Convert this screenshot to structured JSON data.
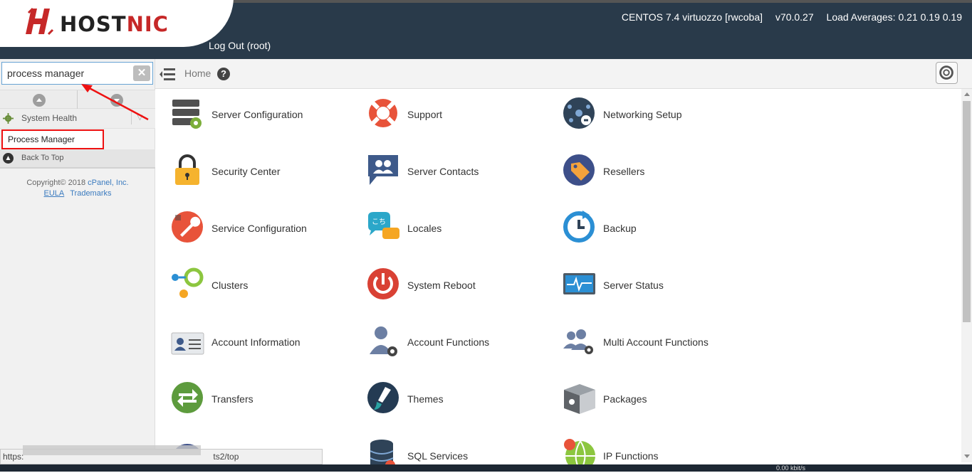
{
  "brand": {
    "logo_prefix": "HOST",
    "logo_suffix": "NIC",
    "accent": "#c62828"
  },
  "header": {
    "server_name": "CENTOS 7.4 virtuozzo [rwcoba]",
    "version": "v70.0.27",
    "load_averages": "Load Averages: 0.21 0.19 0.19",
    "logout_label": "Log Out (root)"
  },
  "breadcrumb": {
    "home_label": "Home",
    "help_glyph": "?"
  },
  "sidebar": {
    "search_value": "process manager",
    "group_label": "System Health",
    "active_item": "Process Manager",
    "back_to_top": "Back To Top",
    "copyright_prefix": "Copyright© 2018",
    "copyright_company": "cPanel, Inc.",
    "eula_label": "EULA",
    "trademarks_label": "Trademarks"
  },
  "tiles": [
    {
      "label": "Server Configuration",
      "icon": "server-config-icon"
    },
    {
      "label": "Support",
      "icon": "lifebuoy-icon"
    },
    {
      "label": "Networking Setup",
      "icon": "network-icon"
    },
    {
      "label": "Security Center",
      "icon": "padlock-icon"
    },
    {
      "label": "Server Contacts",
      "icon": "contacts-icon"
    },
    {
      "label": "Resellers",
      "icon": "tag-icon"
    },
    {
      "label": "Service Configuration",
      "icon": "wrench-icon"
    },
    {
      "label": "Locales",
      "icon": "speech-bubbles-icon"
    },
    {
      "label": "Backup",
      "icon": "clock-icon"
    },
    {
      "label": "Clusters",
      "icon": "clusters-icon"
    },
    {
      "label": "System Reboot",
      "icon": "power-icon"
    },
    {
      "label": "Server Status",
      "icon": "monitor-icon"
    },
    {
      "label": "Account Information",
      "icon": "id-card-icon"
    },
    {
      "label": "Account Functions",
      "icon": "user-gear-icon"
    },
    {
      "label": "Multi Account Functions",
      "icon": "users-gear-icon"
    },
    {
      "label": "Transfers",
      "icon": "transfer-arrows-icon"
    },
    {
      "label": "Themes",
      "icon": "brush-icon"
    },
    {
      "label": "Packages",
      "icon": "box-icon"
    },
    {
      "label": "",
      "icon": "partial-icon"
    },
    {
      "label": "SQL Services",
      "icon": "database-icon"
    },
    {
      "label": "IP Functions",
      "icon": "globe-ip-icon"
    }
  ],
  "status_bar": {
    "url_prefix": "https:",
    "url_suffix": "ts2/top"
  },
  "taskbar": {
    "net": "0.00 kbit/s"
  }
}
